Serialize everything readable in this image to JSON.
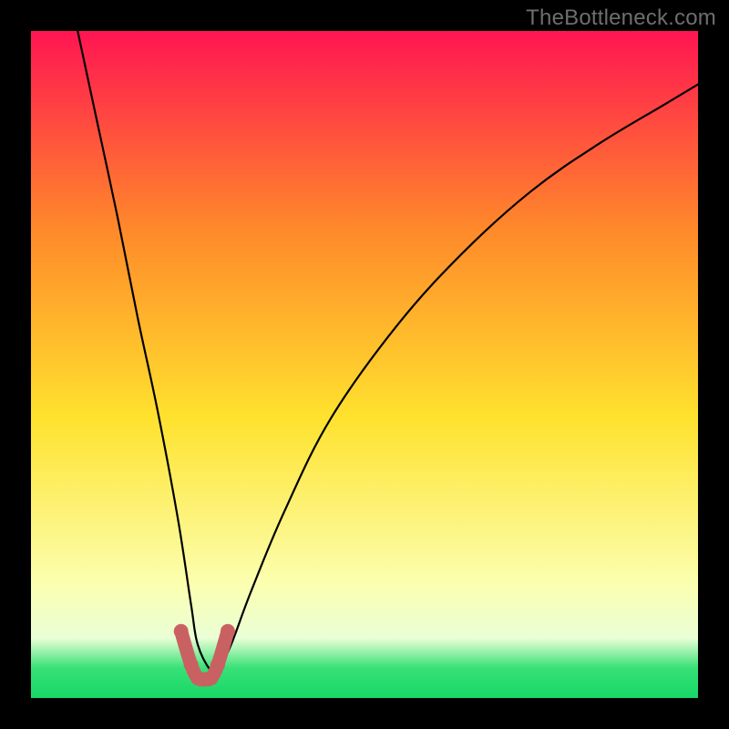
{
  "watermark": "TheBottleneck.com",
  "colors": {
    "bg": "#000000",
    "watermark": "#6e6e6e",
    "curve": "#000000",
    "bottom_curve": "#c96163",
    "gradient_top": "#ff1552",
    "gradient_mid_upper": "#ff8a2a",
    "gradient_mid": "#ffe22e",
    "gradient_lower": "#fbffb0",
    "gradient_pale": "#eaffd6",
    "gradient_green": "#38e177",
    "gradient_bottom": "#16d866"
  },
  "chart_data": {
    "type": "line",
    "title": "",
    "xlabel": "",
    "ylabel": "",
    "xlim": [
      0,
      100
    ],
    "ylim": [
      0,
      100
    ],
    "annotations": [
      "TheBottleneck.com"
    ],
    "series": [
      {
        "name": "bottleneck-curve",
        "x": [
          7,
          10,
          13,
          16,
          19,
          22,
          24,
          25,
          27,
          28,
          30,
          33,
          38,
          45,
          55,
          65,
          75,
          85,
          95,
          100
        ],
        "y": [
          100,
          86,
          72,
          57,
          43,
          27,
          14,
          8,
          4,
          4,
          8,
          16,
          28,
          42,
          56,
          67,
          76,
          83,
          89,
          92
        ]
      },
      {
        "name": "bottom-highlight",
        "x": [
          22.5,
          24,
          25,
          26,
          27,
          28,
          29.5
        ],
        "y": [
          10,
          5,
          3,
          2.8,
          3,
          5,
          10
        ]
      }
    ],
    "minimum_x": 26.5
  }
}
